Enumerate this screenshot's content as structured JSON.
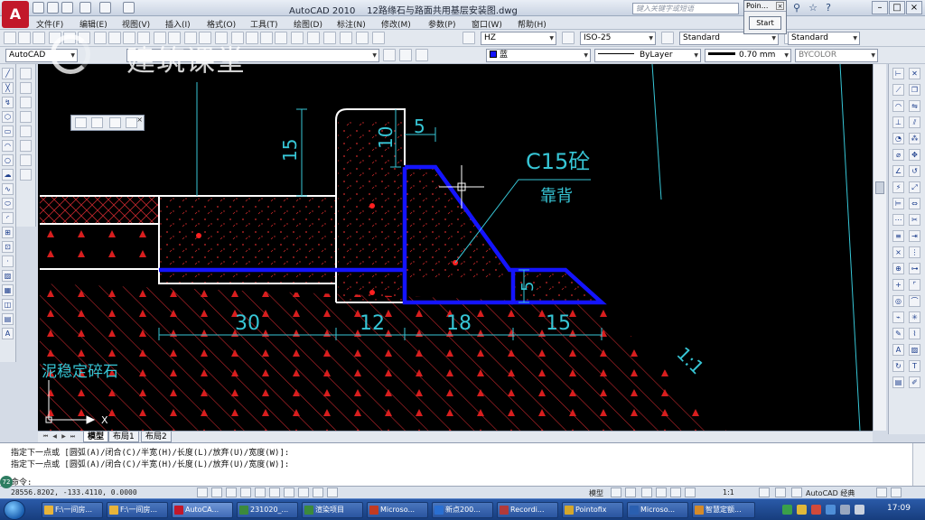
{
  "window": {
    "app_name": "AutoCAD 2010",
    "file_name": "12路缘石与路面共用基层安装图.dwg",
    "search_placeholder": "键入关键字或短语",
    "logo_letter": "A"
  },
  "pointofix": {
    "title": "Poin...",
    "close": "×",
    "start_label": "Start"
  },
  "menu": [
    "文件(F)",
    "编辑(E)",
    "视图(V)",
    "插入(I)",
    "格式(O)",
    "工具(T)",
    "绘图(D)",
    "标注(N)",
    "修改(M)",
    "参数(P)",
    "窗口(W)",
    "帮助(H)"
  ],
  "toolbar": {
    "text_style": "HZ",
    "dim_style": "ISO-25",
    "table_style": "Standard",
    "multileader_style": "Standard",
    "workspace": "AutoCAD",
    "layer": "",
    "color": "蓝",
    "linetype": "ByLayer",
    "lineweight": "0.70 mm",
    "plot_style": "BYCOLOR"
  },
  "watermark": {
    "text": "建筑课堂"
  },
  "drawing": {
    "dim_top": "5",
    "dim_vert_1": "10",
    "dim_vert_2": "15",
    "dim_small": "5",
    "dims_bottom": [
      "30",
      "12",
      "18",
      "15"
    ],
    "label_concrete": "C15砼",
    "label_backing": "靠背",
    "label_gravel": "泥稳定碎石",
    "slope": "1:1",
    "ucs_x": "X",
    "ucs_y": "Y"
  },
  "layout_tabs": [
    "模型",
    "布局1",
    "布局2"
  ],
  "command": {
    "history": [
      "指定下一点或 [圆弧(A)/闭合(C)/半宽(H)/长度(L)/放弃(U)/宽度(W)]:",
      "指定下一点或 [圆弧(A)/闭合(C)/半宽(H)/长度(L)/放弃(U)/宽度(W)]:"
    ],
    "prompt": "命令:"
  },
  "status": {
    "coords": "28556.8202, -133.4110, 0.0000",
    "model_label": "模型",
    "scale": "1:1",
    "workspace": "AutoCAD 经典",
    "badge": "72"
  },
  "taskbar": {
    "items": [
      {
        "label": "F:\\一间房...",
        "color": "#e8b43a"
      },
      {
        "label": "F:\\一间房...",
        "color": "#e8b43a"
      },
      {
        "label": "AutoCA...",
        "color": "#c2182a"
      },
      {
        "label": "231020_...",
        "color": "#3c8a3c"
      },
      {
        "label": "渲染项目",
        "color": "#3c8a3c"
      },
      {
        "label": "Microso...",
        "color": "#c23b22"
      },
      {
        "label": "新点200...",
        "color": "#2a6fd1"
      },
      {
        "label": "Recordi...",
        "color": "#b23a3a"
      },
      {
        "label": "Pointofix",
        "color": "#d4a72c"
      },
      {
        "label": "Microso...",
        "color": "#2a5fb0"
      },
      {
        "label": "智慧定额...",
        "color": "#d48a2a"
      }
    ],
    "clock": "17:09"
  }
}
